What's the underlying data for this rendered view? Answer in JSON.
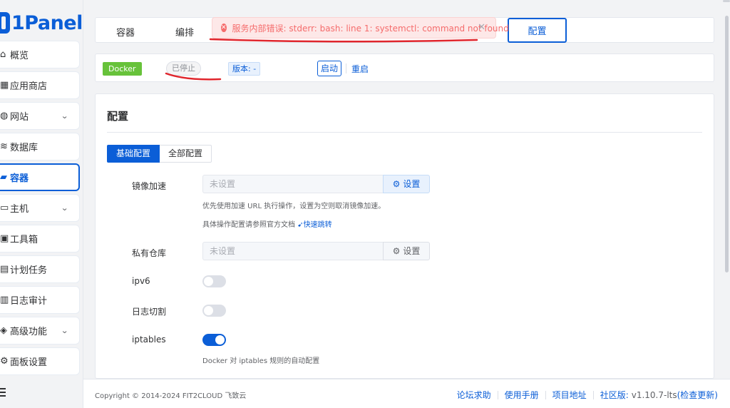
{
  "app": {
    "logo_text": "1Panel"
  },
  "sidebar": {
    "items": [
      {
        "label": "概览",
        "icon": "home-icon",
        "arrow": false,
        "active": false
      },
      {
        "label": "应用商店",
        "icon": "store-icon",
        "arrow": false,
        "active": false
      },
      {
        "label": "网站",
        "icon": "globe-icon",
        "arrow": true,
        "active": false
      },
      {
        "label": "数据库",
        "icon": "database-icon",
        "arrow": false,
        "active": false
      },
      {
        "label": "容器",
        "icon": "docker-icon",
        "arrow": false,
        "active": true
      },
      {
        "label": "主机",
        "icon": "host-icon",
        "arrow": true,
        "active": false
      },
      {
        "label": "工具箱",
        "icon": "toolbox-icon",
        "arrow": false,
        "active": false
      },
      {
        "label": "计划任务",
        "icon": "cron-icon",
        "arrow": false,
        "active": false
      },
      {
        "label": "日志审计",
        "icon": "log-icon",
        "arrow": false,
        "active": false
      },
      {
        "label": "高级功能",
        "icon": "advanced-icon",
        "arrow": true,
        "active": false
      },
      {
        "label": "面板设置",
        "icon": "settings-icon",
        "arrow": false,
        "active": false
      }
    ]
  },
  "tabs": {
    "container": "容器",
    "compose": "编排",
    "config": "配置"
  },
  "toast": {
    "message": "服务内部错误: stderr: bash: line 1: systemctl: command not found",
    "icon": "error-circle-icon"
  },
  "status": {
    "docker_tag": "Docker",
    "state": "已停止",
    "version": "版本: -",
    "start": "启动",
    "restart": "重启"
  },
  "config": {
    "title": "配置",
    "seg_basic": "基础配置",
    "seg_all": "全部配置",
    "mirror": {
      "label": "镜像加速",
      "placeholder": "未设置",
      "button": "设置",
      "help1": "优先使用加速 URL 执行操作，设置为空则取消镜像加速。",
      "help2": "具体操作配置请参照官方文档",
      "help_link": "快速跳转"
    },
    "registry": {
      "label": "私有仓库",
      "placeholder": "未设置",
      "button": "设置"
    },
    "ipv6": {
      "label": "ipv6",
      "on": false
    },
    "log_cut": {
      "label": "日志切割",
      "on": false
    },
    "iptables": {
      "label": "iptables",
      "on": true,
      "help": "Docker 对 iptables 规则的自动配置"
    }
  },
  "footer": {
    "copyright": "Copyright © 2014-2024 FIT2CLOUD 飞致云",
    "forum": "论坛求助",
    "manual": "使用手册",
    "project": "项目地址",
    "edition": "社区版:",
    "version": "v1.10.7-lts",
    "check_update": "(检查更新)"
  },
  "colors": {
    "primary": "#0b5ed7",
    "danger": "#f56c6c",
    "success": "#67c23a"
  }
}
